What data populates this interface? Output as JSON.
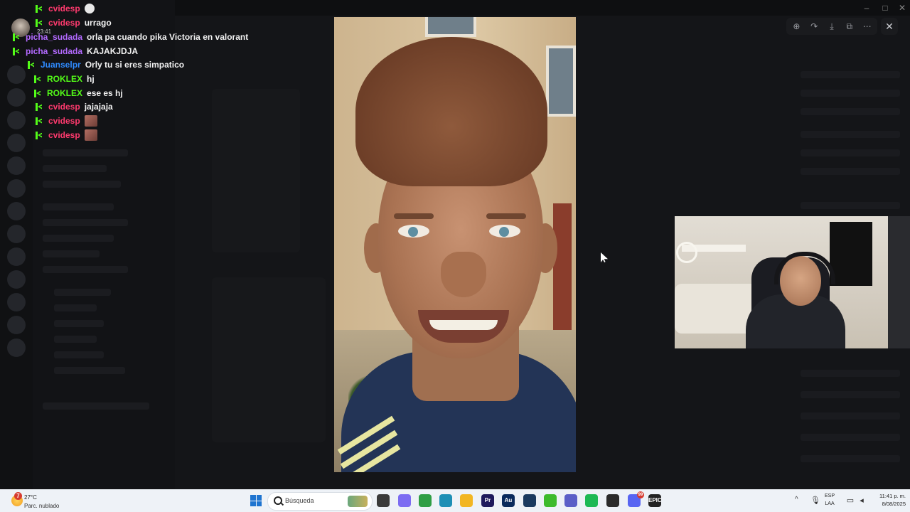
{
  "chat": {
    "messages": [
      {
        "user": "cvidesp",
        "user_color": "#ff3a6e",
        "text": "",
        "emote": "sticker-emote"
      },
      {
        "user": "cvidesp",
        "user_color": "#ff3a6e",
        "text": "urrago"
      },
      {
        "user": "picha_sudada",
        "user_color": "#b36aff",
        "text": "orla pa cuando pika Victoria en valorant"
      },
      {
        "user": "picha_sudada",
        "user_color": "#b36aff",
        "text": "KAJAKJDJA"
      },
      {
        "user": "Juanselpr",
        "user_color": "#2f8bff",
        "text": "Orly tu si eres simpatico"
      },
      {
        "user": "ROKLEX",
        "user_color": "#53fc18",
        "text": "hj"
      },
      {
        "user": "ROKLEX",
        "user_color": "#53fc18",
        "text": "ese es hj"
      },
      {
        "user": "cvidesp",
        "user_color": "#ff3a6e",
        "text": "jajajaja"
      },
      {
        "user": "cvidesp",
        "user_color": "#ff3a6e",
        "text": "",
        "emote": "image-emote"
      },
      {
        "user": "cvidesp",
        "user_color": "#ff3a6e",
        "text": "",
        "emote": "image-emote"
      }
    ],
    "overlay_time": "23:41"
  },
  "viewer": {
    "tools": [
      "zoom-in-icon",
      "forward-icon",
      "download-icon",
      "open-external-icon",
      "more-icon"
    ],
    "close_icon": "close-icon"
  },
  "taskbar": {
    "weather": {
      "badge": "7",
      "temp": "27°C",
      "desc": "Parc. nublado"
    },
    "search_placeholder": "Búsqueda",
    "apps": [
      {
        "name": "file-explorer-app",
        "label": "",
        "color": "#3a3a3a"
      },
      {
        "name": "copilot-app",
        "label": "",
        "color": "#7c6cf2"
      },
      {
        "name": "chrome-app",
        "label": "",
        "color": "#2f9e44"
      },
      {
        "name": "edge-app",
        "label": "",
        "color": "#1d8fb5"
      },
      {
        "name": "folder-app",
        "label": "",
        "color": "#f2b622"
      },
      {
        "name": "premiere-app",
        "label": "Pr",
        "color": "#1f1a5c"
      },
      {
        "name": "audition-app",
        "label": "Au",
        "color": "#0a2a5c"
      },
      {
        "name": "steam-app",
        "label": "",
        "color": "#1b3a5f"
      },
      {
        "name": "green-app",
        "label": "",
        "color": "#3dbb2c"
      },
      {
        "name": "teams-app",
        "label": "",
        "color": "#5b5fc7"
      },
      {
        "name": "spotify-app",
        "label": "",
        "color": "#1db954"
      },
      {
        "name": "obs-app",
        "label": "",
        "color": "#2b2b2b"
      },
      {
        "name": "discord-app",
        "label": "",
        "color": "#5865f2",
        "badge": "99"
      },
      {
        "name": "epic-games-app",
        "label": "EPIC",
        "color": "#222222"
      }
    ],
    "lang_line1": "ESP",
    "lang_line2": "LAA",
    "time": "11:41 p. m.",
    "date": "8/08/2025"
  },
  "colors": {
    "badge_green": "#53fc18",
    "taskbar_bg": "#eef2f7"
  }
}
